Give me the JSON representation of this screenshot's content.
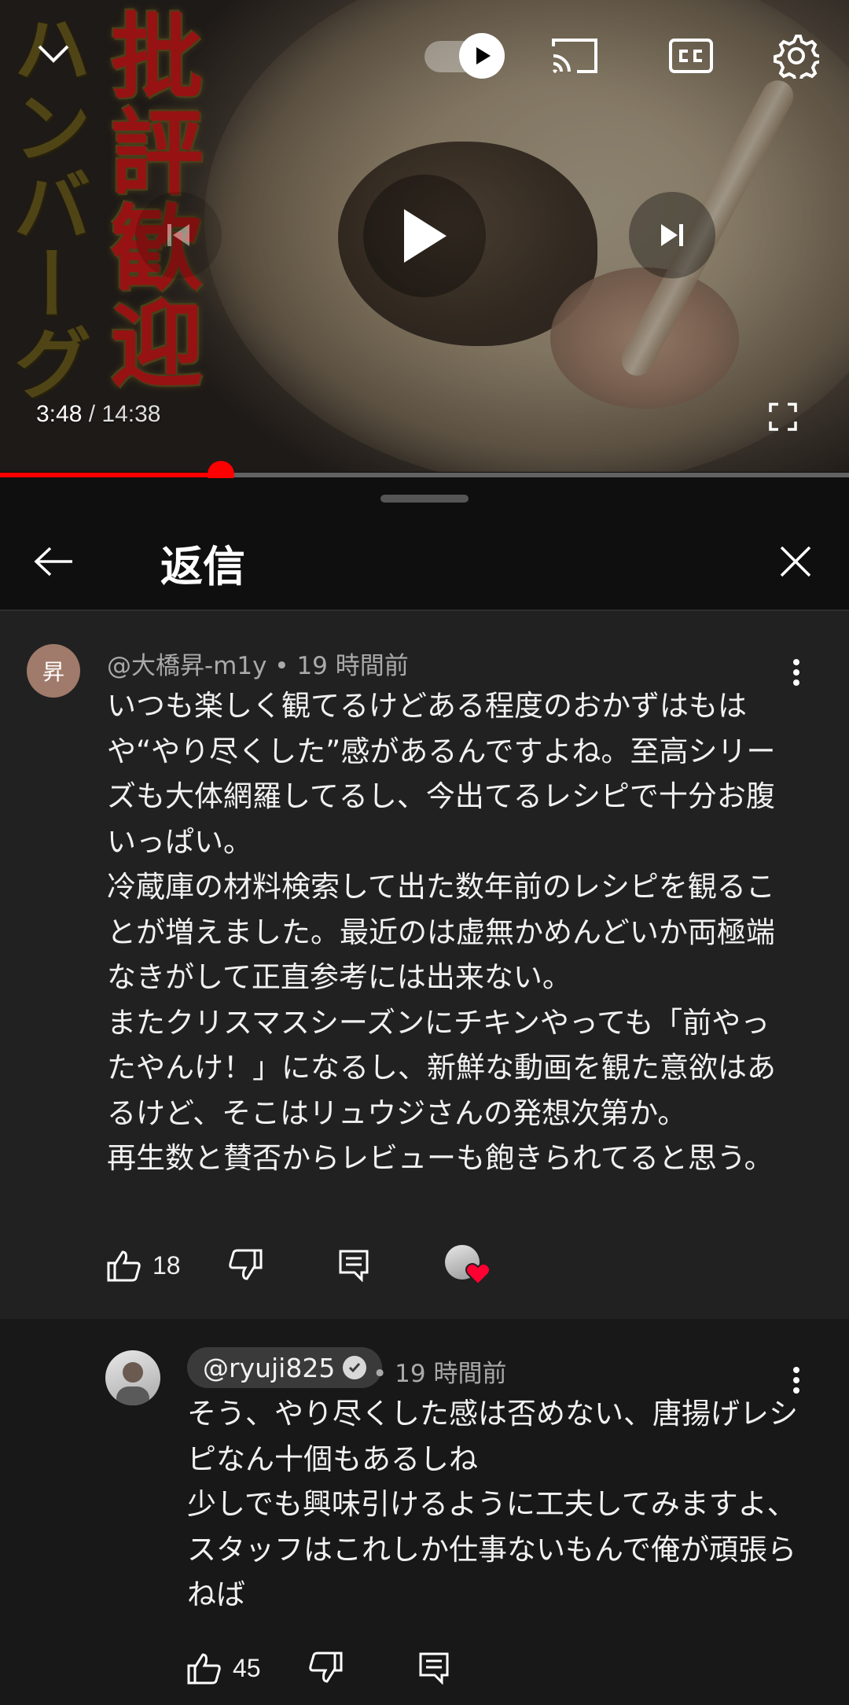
{
  "player": {
    "thumbnail_text_red": "批評歓迎",
    "thumbnail_text_olive": "ハンバーグ",
    "current_time": "3:48",
    "separator": " / ",
    "duration": "14:38",
    "progress": 0.26,
    "icons": {
      "minimize": "chevron-down-icon",
      "autoplay": "autoplay-toggle-icon",
      "cast": "cast-icon",
      "captions": "cc-icon",
      "settings": "gear-icon",
      "previous": "skip-previous-icon",
      "play": "play-icon",
      "next": "skip-next-icon",
      "fullscreen": "fullscreen-icon"
    },
    "accent": "#ff0000"
  },
  "panel": {
    "title": "返信",
    "back_icon": "back-arrow-icon",
    "close_icon": "close-icon"
  },
  "parent_comment": {
    "avatar_letter": "昇",
    "author": "@大橋昇-m1y",
    "time": "19 時間前",
    "text": "いつも楽しく観てるけどある程度のおかずはもはや“やり尽くした”感があるんですよね。至高シリーズも大体網羅してるし、今出てるレシピで十分お腹いっぱい。\n冷蔵庫の材料検索して出た数年前のレシピを観ることが増えました。最近のは虚無かめんどいか両極端なきがして正直参考には出来ない。\nまたクリスマスシーズンにチキンやっても「前やったやんけ！」になるし、新鮮な動画を観た意欲はあるけど、そこはリュウジさんの発想次第か。\n再生数と賛否からレビューも飽きられてると思う。",
    "likes": "18",
    "creator_heart": true
  },
  "reply_comment": {
    "author": "@ryuji825",
    "time": "19 時間前",
    "text": "そう、やり尽くした感は否めない、唐揚げレシピなん十個もあるしね\n少しでも興味引けるように工夫してみますよ、スタッフはこれしか仕事ないもんで俺が頑張らねば",
    "likes": "45",
    "verified": true
  }
}
